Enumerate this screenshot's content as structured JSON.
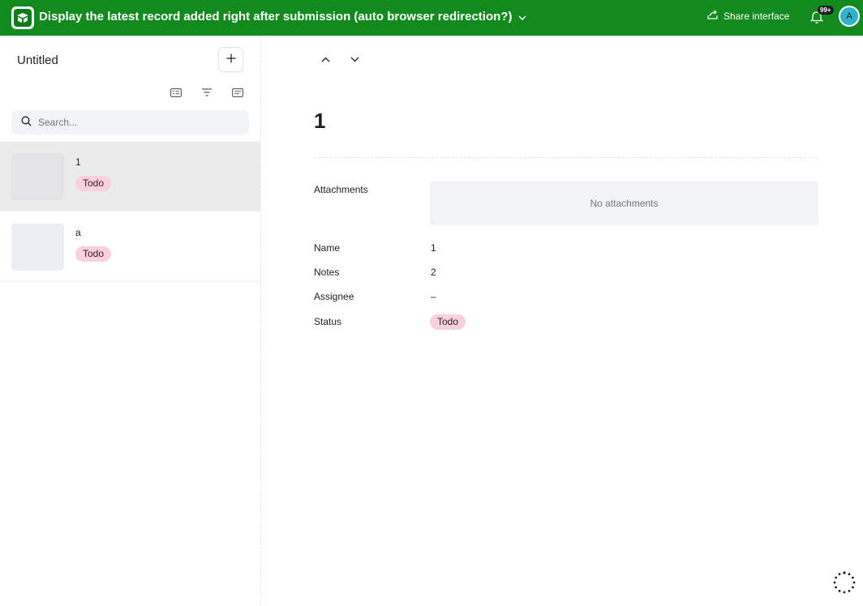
{
  "header": {
    "title": "Display the latest record added right after submission (auto browser redirection?)",
    "share_label": "Share interface",
    "notification_count": "99+",
    "avatar_initial": "A",
    "background": "#138a1e"
  },
  "list": {
    "title": "Untitled",
    "search_placeholder": "Search...",
    "records": [
      {
        "name": "1",
        "status": "Todo",
        "selected": true
      },
      {
        "name": "a",
        "status": "Todo",
        "selected": false
      }
    ]
  },
  "detail": {
    "title": "1",
    "attachments_label": "Attachments",
    "attachments_empty": "No attachments",
    "fields": [
      {
        "label": "Name",
        "value": "1"
      },
      {
        "label": "Notes",
        "value": "2"
      },
      {
        "label": "Assignee",
        "value": "–"
      },
      {
        "label": "Status",
        "value": "Todo"
      }
    ]
  },
  "colors": {
    "status_pill": "#fbd0de",
    "selected_row": "#ebebeb",
    "avatar": "#2bb5c6"
  }
}
